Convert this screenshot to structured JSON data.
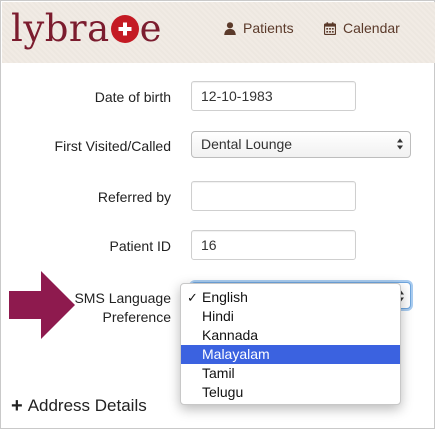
{
  "brand": {
    "prefix": "lybra",
    "suffix": "e"
  },
  "nav": {
    "patients": "Patients",
    "calendar": "Calendar"
  },
  "form": {
    "dob_label": "Date of birth",
    "dob_value": "12-10-1983",
    "first_visited_label": "First Visited/Called",
    "first_visited_value": "Dental Lounge",
    "referred_label": "Referred by",
    "referred_value": "",
    "patient_id_label": "Patient ID",
    "patient_id_value": "16",
    "sms_label_line1": "SMS Language",
    "sms_label_line2": "Preference",
    "sms_value": "English"
  },
  "sms_options": [
    {
      "label": "English",
      "checked": true,
      "highlighted": false
    },
    {
      "label": "Hindi",
      "checked": false,
      "highlighted": false
    },
    {
      "label": "Kannada",
      "checked": false,
      "highlighted": false
    },
    {
      "label": "Malayalam",
      "checked": false,
      "highlighted": true
    },
    {
      "label": "Tamil",
      "checked": false,
      "highlighted": false
    },
    {
      "label": "Telugu",
      "checked": false,
      "highlighted": false
    }
  ],
  "check_mark": "✓",
  "address_section": "Address Details",
  "colors": {
    "brand": "#7b1c2e",
    "logo_cross": "#c41a23",
    "highlight": "#3b62e0",
    "annotation_arrow": "#8e1a4e"
  }
}
